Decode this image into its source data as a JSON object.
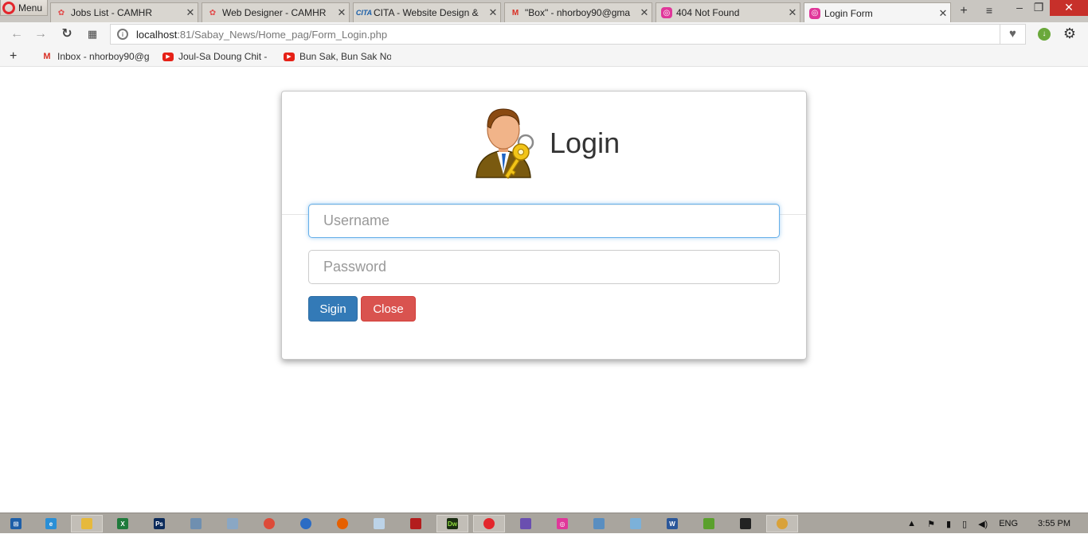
{
  "browser": {
    "menu_label": "Menu",
    "tabs": [
      {
        "title": "Jobs List - CAMHR",
        "favicon": "camhr-icon"
      },
      {
        "title": "Web Designer - CAMHR",
        "favicon": "camhr-icon"
      },
      {
        "title": "CITA - Website Design &",
        "favicon": "cita-icon",
        "fav_text": "CITA"
      },
      {
        "title": "\"Box\" - nhorboy90@gma",
        "favicon": "gmail-icon",
        "fav_text": "M"
      },
      {
        "title": "404 Not Found",
        "favicon": "localhost-icon"
      },
      {
        "title": "Login Form",
        "favicon": "localhost-icon",
        "active": true
      }
    ],
    "address": {
      "host": "localhost",
      "path": ":81/Sabay_News/Home_pag/Form_Login.php"
    },
    "bookmarks": [
      {
        "label": "Inbox - nhorboy90@g",
        "icon": "gmail-icon",
        "ico_text": "M"
      },
      {
        "label": "Joul-Sa Doung Chit -",
        "icon": "youtube-icon",
        "ico_text": "▶"
      },
      {
        "label": "Bun Sak, Bun Sak Nor",
        "icon": "youtube-icon",
        "ico_text": "▶"
      }
    ]
  },
  "login": {
    "title": "Login",
    "username_placeholder": "Username",
    "password_placeholder": "Password",
    "signin_label": "Sigin",
    "close_label": "Close"
  },
  "taskbar": {
    "language": "ENG",
    "time": "3:55 PM"
  },
  "colors": {
    "primary": "#337ab7",
    "danger": "#d9534f",
    "focus": "#66afe9"
  }
}
